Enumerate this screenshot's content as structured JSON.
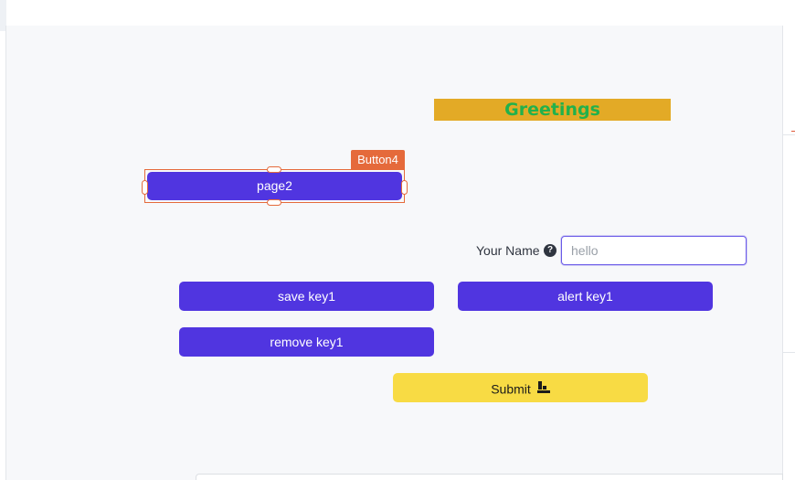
{
  "greeting": {
    "text": "Greetings"
  },
  "selection": {
    "tag": "Button4"
  },
  "buttons": {
    "page2": "page2",
    "save": "save key1",
    "alert": "alert key1",
    "remove": "remove key1",
    "submit": "Submit"
  },
  "form": {
    "name_label": "Your Name",
    "name_placeholder": "hello",
    "help_icon": "?"
  },
  "icons": {
    "help": "question-circle-icon",
    "submit": "stamp-icon"
  },
  "colors": {
    "primary_button": "#5035e0",
    "submit_button": "#f8db44",
    "greeting_background": "#e3aa26",
    "greeting_text": "#22b14c",
    "selection_accent": "#e56a3b"
  }
}
